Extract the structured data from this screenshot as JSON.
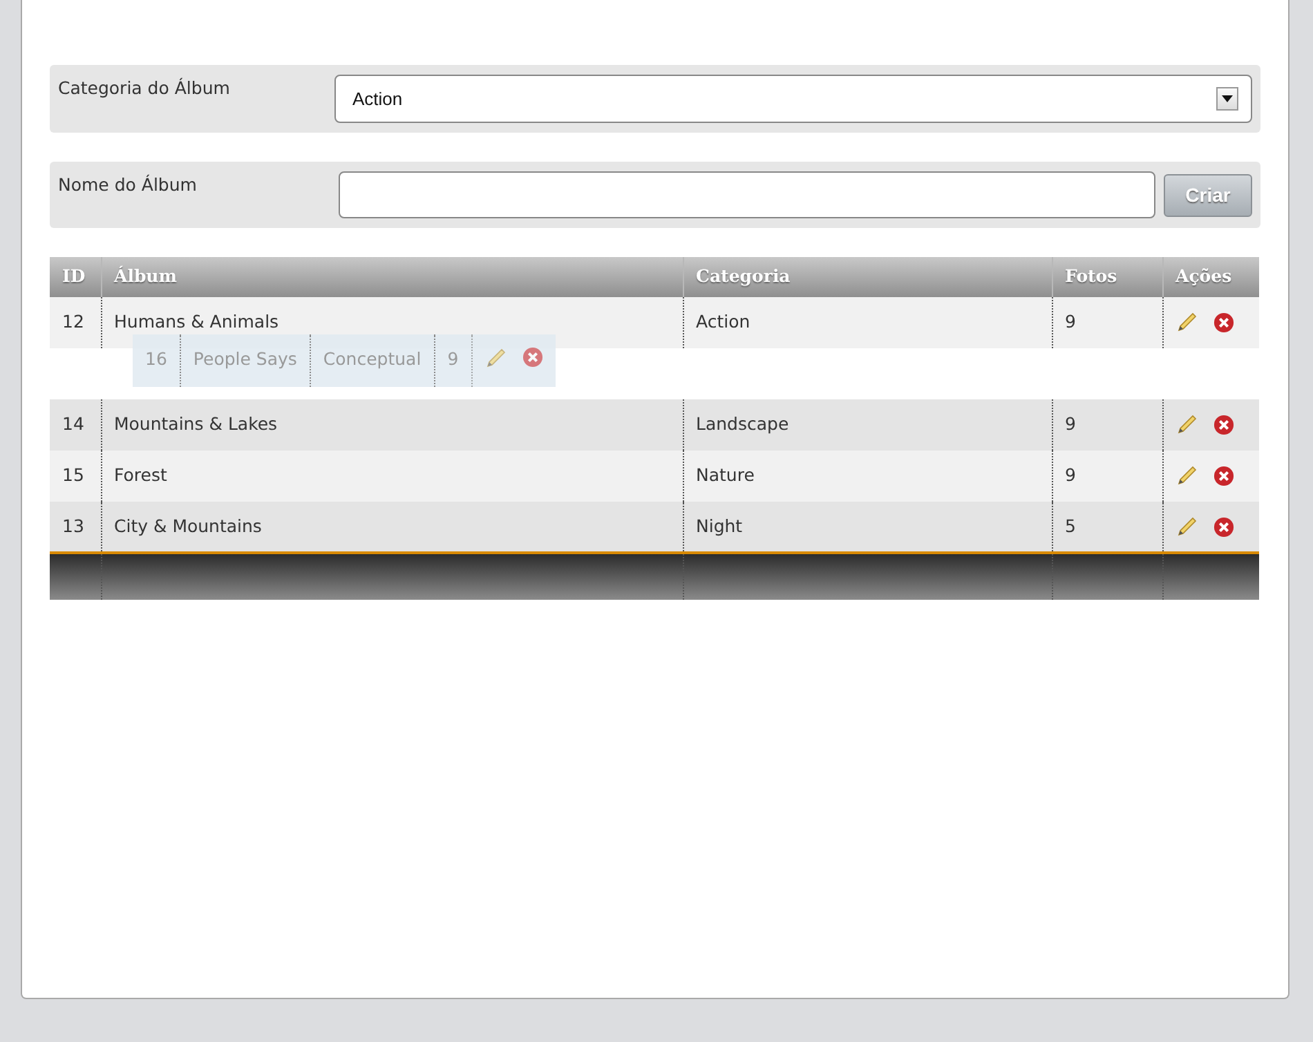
{
  "form": [
    {
      "kind": "select",
      "label": "Categoria do Álbum",
      "value": "Action"
    },
    {
      "kind": "text",
      "label": "Nome do Álbum",
      "button": "Criar"
    }
  ],
  "table": {
    "columns": [
      "ID",
      "Álbum",
      "Categoria",
      "Fotos",
      "Ações"
    ],
    "rows": [
      {
        "kind": "row",
        "id": "12",
        "album": "Humans & Animals",
        "category": "Action",
        "photos": "9"
      },
      {
        "kind": "placeholder"
      },
      {
        "kind": "row",
        "id": "14",
        "album": "Mountains & Lakes",
        "category": "Landscape",
        "photos": "9"
      },
      {
        "kind": "row",
        "id": "15",
        "album": "Forest",
        "category": "Nature",
        "photos": "9"
      },
      {
        "kind": "row",
        "id": "13",
        "album": "City & Mountains",
        "category": "Night",
        "photos": "5"
      }
    ],
    "dragged_row": {
      "id": "16",
      "album": "People Says",
      "category": "Conceptual",
      "photos": "9"
    }
  }
}
